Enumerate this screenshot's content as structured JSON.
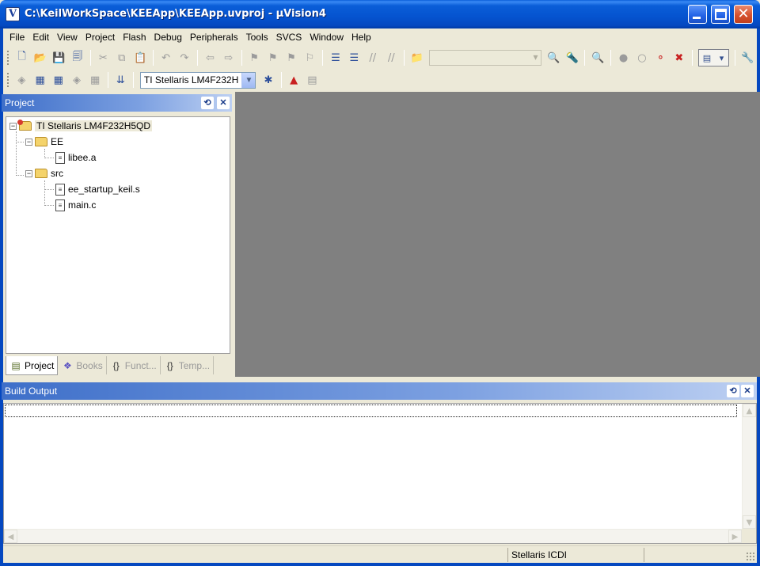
{
  "window": {
    "title": "C:\\KeilWorkSpace\\KEEApp\\KEEApp.uvproj - µVision4",
    "app_icon_letter": "V"
  },
  "menu": [
    "File",
    "Edit",
    "View",
    "Project",
    "Flash",
    "Debug",
    "Peripherals",
    "Tools",
    "SVCS",
    "Window",
    "Help"
  ],
  "build_toolbar": {
    "target_select": "TI Stellaris LM4F232H"
  },
  "project_panel": {
    "title": "Project",
    "tree": {
      "root": "TI Stellaris LM4F232H5QD",
      "groups": [
        {
          "name": "EE",
          "files": [
            "libee.a"
          ]
        },
        {
          "name": "src",
          "files": [
            "ee_startup_keil.s",
            "main.c"
          ]
        }
      ]
    },
    "tabs": [
      {
        "label": "Project",
        "icon": "project-tab-icon"
      },
      {
        "label": "Books",
        "icon": "books-tab-icon"
      },
      {
        "label": "Funct...",
        "icon": "functions-tab-icon"
      },
      {
        "label": "Temp...",
        "icon": "templates-tab-icon"
      }
    ]
  },
  "build_output": {
    "title": "Build Output"
  },
  "statusbar": {
    "debugger": "Stellaris ICDI"
  }
}
